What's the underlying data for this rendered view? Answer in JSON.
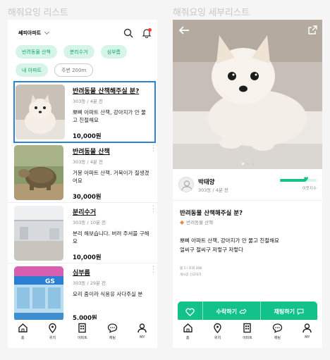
{
  "captions": {
    "list": "해줘요잉 리스트",
    "detail": "해줘요잉 세부리스트"
  },
  "list_screen": {
    "location": "쎄피아파트",
    "chips": [
      "반려동물 산책",
      "분리수거",
      "심부름",
      "내 아파트",
      "주변 200m"
    ],
    "items": [
      {
        "title": "반려동물 산책해주실 분?",
        "meta": "303동 / 4분 전",
        "desc": "뽀삐 아파트 산책, 강아지가 안 물고 친절해요",
        "price": "10,000원",
        "image": "white-pomeranian-photo"
      },
      {
        "title": "반려동물 산책",
        "meta": "303동 / 4분 전",
        "desc": "거봉 아파트 산책. 거북이가 질생겼어요",
        "price": "30,000원",
        "image": "tortoise-photo"
      },
      {
        "title": "분리수거",
        "meta": "303동 / 10분 전",
        "desc": "분리 해보습니다. 버려 주셔블 구해요",
        "price": "10,000원",
        "image": "recycling-room-photo"
      },
      {
        "title": "심부름",
        "meta": "303동 / 29분 전",
        "desc": "요리 줌이라 식용유 사다주실 분",
        "price": "5,000원",
        "image": "convenience-store-photo"
      }
    ]
  },
  "nav": [
    {
      "label": "홈",
      "icon": "home-icon"
    },
    {
      "label": "위치",
      "icon": "location-pin-icon"
    },
    {
      "label": "아파트",
      "icon": "apartment-icon"
    },
    {
      "label": "채팅",
      "icon": "chat-icon"
    },
    {
      "label": "MY",
      "icon": "user-icon"
    }
  ],
  "detail_screen": {
    "user_name": "박태양",
    "user_meta": "303동 / 4분 전",
    "gauge_label": "이웃지수",
    "gauge_level": 0.72,
    "title": "반려동물 산책해주실 분?",
    "category": "반려동물 산책",
    "body_line1": "뽀삐 아파트 산책, 강아지가 안 물고 친절해요",
    "body_line2": "얼씨구 절씨구 저렇구 저렇다",
    "views": "찜 1 / 조회 208",
    "report": "게시글 신고하기",
    "accept_label": "수락하기",
    "chat_label": "채팅하기",
    "carousel_count": 3,
    "carousel_index": 1
  },
  "colors": {
    "accent": "#12c28a",
    "chip_bg": "#d6f5e8",
    "selection": "#2c83d6"
  }
}
